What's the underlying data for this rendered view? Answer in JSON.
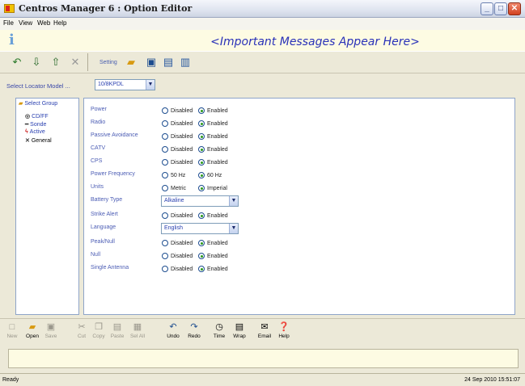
{
  "window": {
    "title": "Centros Manager 6 : Option Editor"
  },
  "menu": [
    "File",
    "View",
    "Web",
    "Help"
  ],
  "banner": {
    "message": "<Important Messages Appear Here>"
  },
  "toolbar": {
    "setting_label": "Setting"
  },
  "locator": {
    "label": "Select Locator Model ...",
    "value": "10/8KPDL"
  },
  "tree": {
    "root": "Select Group",
    "items": [
      "CD/FF",
      "Sonde",
      "Active",
      "General"
    ],
    "selected": "General"
  },
  "options": [
    {
      "label": "Power",
      "type": "radio",
      "choices": [
        "Disabled",
        "Enabled"
      ],
      "selected": 1
    },
    {
      "label": "Radio",
      "type": "radio",
      "choices": [
        "Disabled",
        "Enabled"
      ],
      "selected": 1
    },
    {
      "label": "Passive Avoidance",
      "type": "radio",
      "choices": [
        "Disabled",
        "Enabled"
      ],
      "selected": 1
    },
    {
      "label": "CATV",
      "type": "radio",
      "choices": [
        "Disabled",
        "Enabled"
      ],
      "selected": 1
    },
    {
      "label": "CPS",
      "type": "radio",
      "choices": [
        "Disabled",
        "Enabled"
      ],
      "selected": 1
    },
    {
      "label": "Power Frequency",
      "type": "radio",
      "choices": [
        "50 Hz",
        "60 Hz"
      ],
      "selected": 1
    },
    {
      "label": "Units",
      "type": "radio",
      "choices": [
        "Metric",
        "Imperial"
      ],
      "selected": 1
    },
    {
      "label": "Battery Type",
      "type": "select",
      "value": "Alkaline"
    },
    {
      "label": "Strike Alert",
      "type": "radio",
      "choices": [
        "Disabled",
        "Enabled"
      ],
      "selected": 1
    },
    {
      "label": "Language",
      "type": "select",
      "value": "English"
    },
    {
      "label": "Peak/Null",
      "type": "radio",
      "choices": [
        "Disabled",
        "Enabled"
      ],
      "selected": 1
    },
    {
      "label": "Null",
      "type": "radio",
      "choices": [
        "Disabled",
        "Enabled"
      ],
      "selected": 1
    },
    {
      "label": "Single Antenna",
      "type": "radio",
      "choices": [
        "Disabled",
        "Enabled"
      ],
      "selected": 1
    }
  ],
  "bottom_toolbar": [
    {
      "label": "New",
      "icon": "new-file-icon",
      "enabled": false
    },
    {
      "label": "Open",
      "icon": "open-folder-icon",
      "enabled": true
    },
    {
      "label": "Save",
      "icon": "save-icon",
      "enabled": false
    },
    {
      "label": "Cut",
      "icon": "scissors-icon",
      "enabled": false
    },
    {
      "label": "Copy",
      "icon": "copy-icon",
      "enabled": false
    },
    {
      "label": "Paste",
      "icon": "paste-icon",
      "enabled": false
    },
    {
      "label": "Sel All",
      "icon": "select-all-icon",
      "enabled": false
    },
    {
      "label": "Undo",
      "icon": "undo-icon",
      "enabled": true
    },
    {
      "label": "Redo",
      "icon": "redo-icon",
      "enabled": true
    },
    {
      "label": "Time",
      "icon": "clock-icon",
      "enabled": true
    },
    {
      "label": "Wrap",
      "icon": "wrap-icon",
      "enabled": true
    },
    {
      "label": "Email",
      "icon": "email-icon",
      "enabled": true
    },
    {
      "label": "Help",
      "icon": "help-icon",
      "enabled": true
    }
  ],
  "status": {
    "left": "Ready",
    "right": "24 Sep 2010  15:51:07"
  }
}
